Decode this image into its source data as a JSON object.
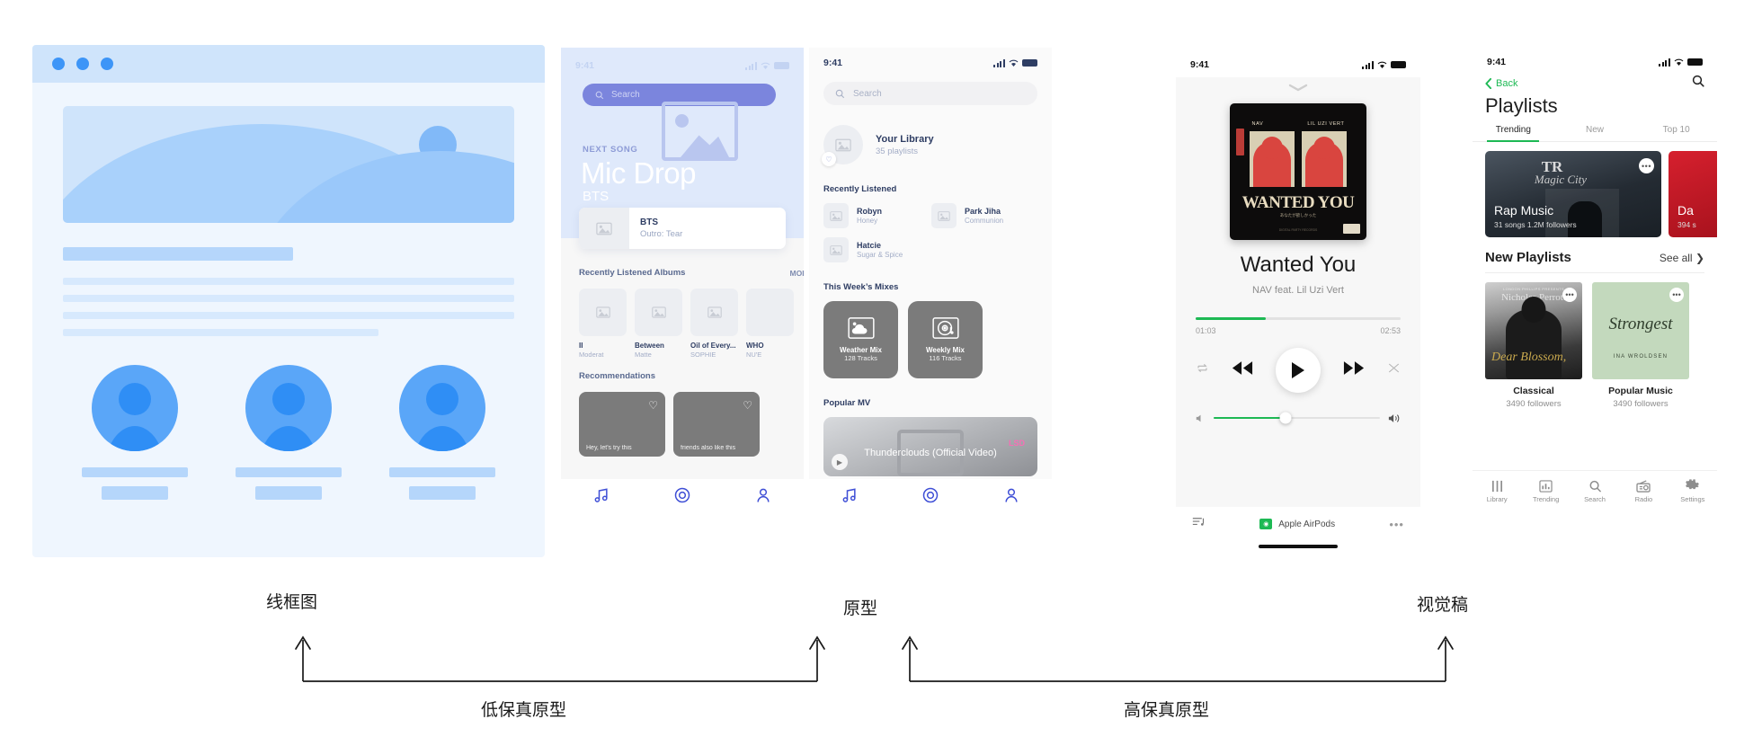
{
  "annotations": {
    "wireframe": "线框图",
    "prototype": "原型",
    "visual": "视觉稿",
    "low_fidelity": "低保真原型",
    "high_fidelity": "高保真原型"
  },
  "wireframe_panel": {
    "window_dots": 3,
    "image_placeholder": "hero-image",
    "text_lines": 4,
    "avatar_count": 3
  },
  "phone_lofi_home": {
    "status": {
      "time": "9:41"
    },
    "search_placeholder": "Search",
    "next_song_label": "NEXT SONG",
    "next_song_title": "Mic Drop",
    "next_song_artist": "BTS",
    "now_card": {
      "title": "BTS",
      "subtitle": "Outro: Tear"
    },
    "albums_section": {
      "heading": "Recently Listened Albums",
      "more": "MORE"
    },
    "albums": [
      {
        "title": "II",
        "artist": "Moderat"
      },
      {
        "title": "Between",
        "artist": "Matte"
      },
      {
        "title": "Oil of Every...",
        "artist": "SOPHIE"
      },
      {
        "title": "WHO",
        "artist": "NU'E"
      }
    ],
    "recommendations_heading": "Recommendations",
    "recommendations": [
      {
        "label": "Hey, let's try this"
      },
      {
        "label": "friends also like this"
      }
    ],
    "nav": [
      {
        "name": "music-note-icon"
      },
      {
        "name": "discover-icon"
      },
      {
        "name": "profile-icon"
      }
    ]
  },
  "phone_lofi_library": {
    "status": {
      "time": "9:41"
    },
    "search_placeholder": "Search",
    "library": {
      "title": "Your Library",
      "subtitle": "35 playlists"
    },
    "recently_listened_heading": "Recently Listened",
    "recently_listened": [
      {
        "title": "Robyn",
        "subtitle": "Honey"
      },
      {
        "title": "Park Jiha",
        "subtitle": "Communion"
      },
      {
        "title": "Hatcie",
        "subtitle": "Sugar & Spice"
      }
    ],
    "mixes_heading": "This Week’s Mixes",
    "mixes": [
      {
        "title": "Weather Mix",
        "subtitle": "128 Tracks",
        "icon": "cloud-icon"
      },
      {
        "title": "Weekly Mix",
        "subtitle": "116 Tracks",
        "icon": "vinyl-icon"
      }
    ],
    "popular_mv_heading": "Popular MV",
    "popular_mv": {
      "artist": "LSD",
      "title": "Thunderclouds (Official Video)"
    },
    "nav": [
      {
        "name": "music-note-icon"
      },
      {
        "name": "discover-icon"
      },
      {
        "name": "profile-icon"
      }
    ]
  },
  "phone_hifi_player": {
    "status": {
      "time": "9:41"
    },
    "artwork": {
      "left_name": "NAV",
      "right_name": "LIL UZI VERT",
      "album_text": "WANTED YOU",
      "jp_text": "あなたが欲しかった",
      "small_text": "DIGITAL PARTY RECORDS",
      "parental": "PARENTAL ADVISORY"
    },
    "track_title": "Wanted You",
    "track_artist": "NAV feat. Lil Uzi Vert",
    "elapsed": "01:03",
    "duration": "02:53",
    "progress_percent": 34,
    "volume_percent": 43,
    "device": "Apple AirPods",
    "controls": [
      "repeat-icon",
      "previous-icon",
      "play-icon",
      "next-icon",
      "shuffle-icon"
    ],
    "queue_icon": "queue-icon",
    "more_icon": "more-icon",
    "accent": "#1db954"
  },
  "phone_hifi_playlists": {
    "status": {
      "time": "9:41"
    },
    "back_label": "Back",
    "search_icon": "search-icon",
    "page_title": "Playlists",
    "tabs": [
      {
        "label": "Trending",
        "active": true
      },
      {
        "label": "New",
        "active": false
      },
      {
        "label": "Top 10",
        "active": false
      }
    ],
    "featured": [
      {
        "name": "Rap Music",
        "meta": "31 songs  1.2M followers",
        "art_text": "TR",
        "art_sub": "Magic City"
      },
      {
        "name": "Da",
        "meta": "394 s"
      }
    ],
    "new_section": {
      "heading": "New Playlists",
      "see_all": "See all"
    },
    "new_playlists": [
      {
        "title": "Classical",
        "followers": "3490 followers",
        "art_title": "Dear Blossom,",
        "art_top": "LONDON PHILLIPS PRESENTS",
        "art_name": "Nicholas Perrott"
      },
      {
        "title": "Popular Music",
        "followers": "3490 followers",
        "art_title": "Strongest",
        "art_name": "INA WROLDSEN"
      }
    ],
    "tabbar": [
      {
        "label": "Library",
        "icon": "library-icon"
      },
      {
        "label": "Trending",
        "icon": "trending-icon"
      },
      {
        "label": "Search",
        "icon": "search-icon"
      },
      {
        "label": "Radio",
        "icon": "radio-icon"
      },
      {
        "label": "Settings",
        "icon": "settings-icon"
      }
    ],
    "accent": "#1db954"
  }
}
